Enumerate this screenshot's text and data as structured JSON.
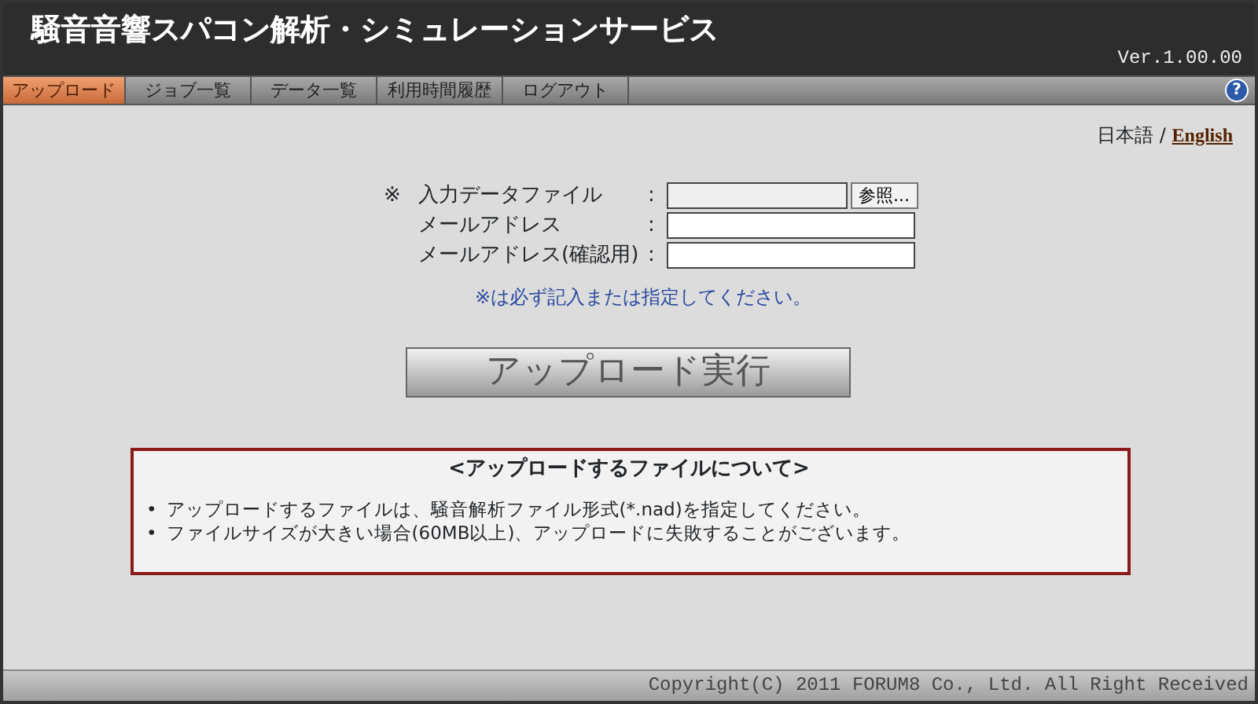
{
  "header": {
    "title": "騒音音響スパコン解析・シミュレーションサービス",
    "version": "Ver.1.00.00"
  },
  "nav": [
    {
      "label": "アップロード",
      "selected": true
    },
    {
      "label": "ジョブ一覧",
      "selected": false
    },
    {
      "label": "データ一覧",
      "selected": false
    },
    {
      "label": "利用時間履歴",
      "selected": false
    },
    {
      "label": "ログアウト",
      "selected": false
    }
  ],
  "help": {
    "label": "?"
  },
  "language": {
    "current": "日本語",
    "separator": "/",
    "link": "English"
  },
  "form": {
    "fields": [
      {
        "mark": "※",
        "label": "入力データファイル",
        "colon": ":",
        "kind": "file",
        "button": "参照..."
      },
      {
        "label": "メールアドレス",
        "colon": ":",
        "kind": "text"
      },
      {
        "label": "メールアドレス(確認用)",
        "colon": ":",
        "kind": "text"
      }
    ],
    "note": "※は必ず記入または指定してください。",
    "submit": "アップロード実行"
  },
  "notice": {
    "title": "<アップロードするファイルについて>",
    "items": [
      {
        "bullet": "•",
        "text": "アップロードするファイルは、騒音解析ファイル形式(*.nad)を指定してください。"
      },
      {
        "bullet": "•",
        "text": "ファイルサイズが大きい場合(60MB以上)、アップロードに失敗することがございます。"
      }
    ]
  },
  "footer": "Copyright(C) 2011 FORUM8 Co., Ltd. All Right Received"
}
